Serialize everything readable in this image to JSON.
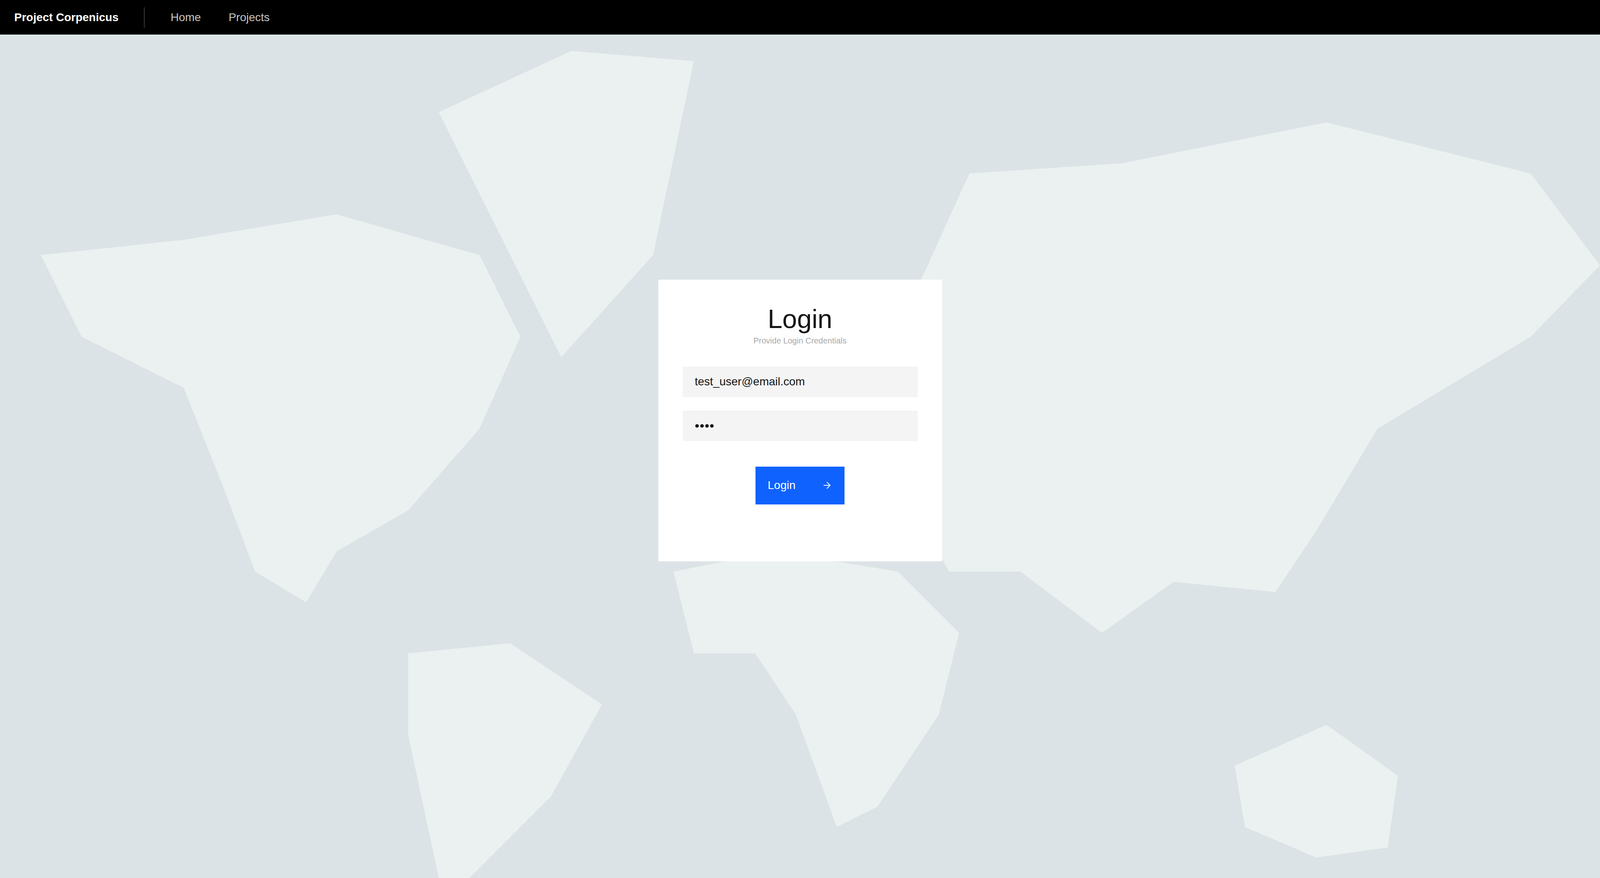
{
  "header": {
    "brand": "Project Corpenicus",
    "nav": [
      {
        "label": "Home"
      },
      {
        "label": "Projects"
      }
    ]
  },
  "login": {
    "title": "Login",
    "subtitle": "Provide Login Credentials",
    "fields": [
      {
        "name": "email",
        "value": "test_user@email.com"
      },
      {
        "name": "password",
        "value": "••••"
      }
    ],
    "button": {
      "label": "Login"
    }
  }
}
